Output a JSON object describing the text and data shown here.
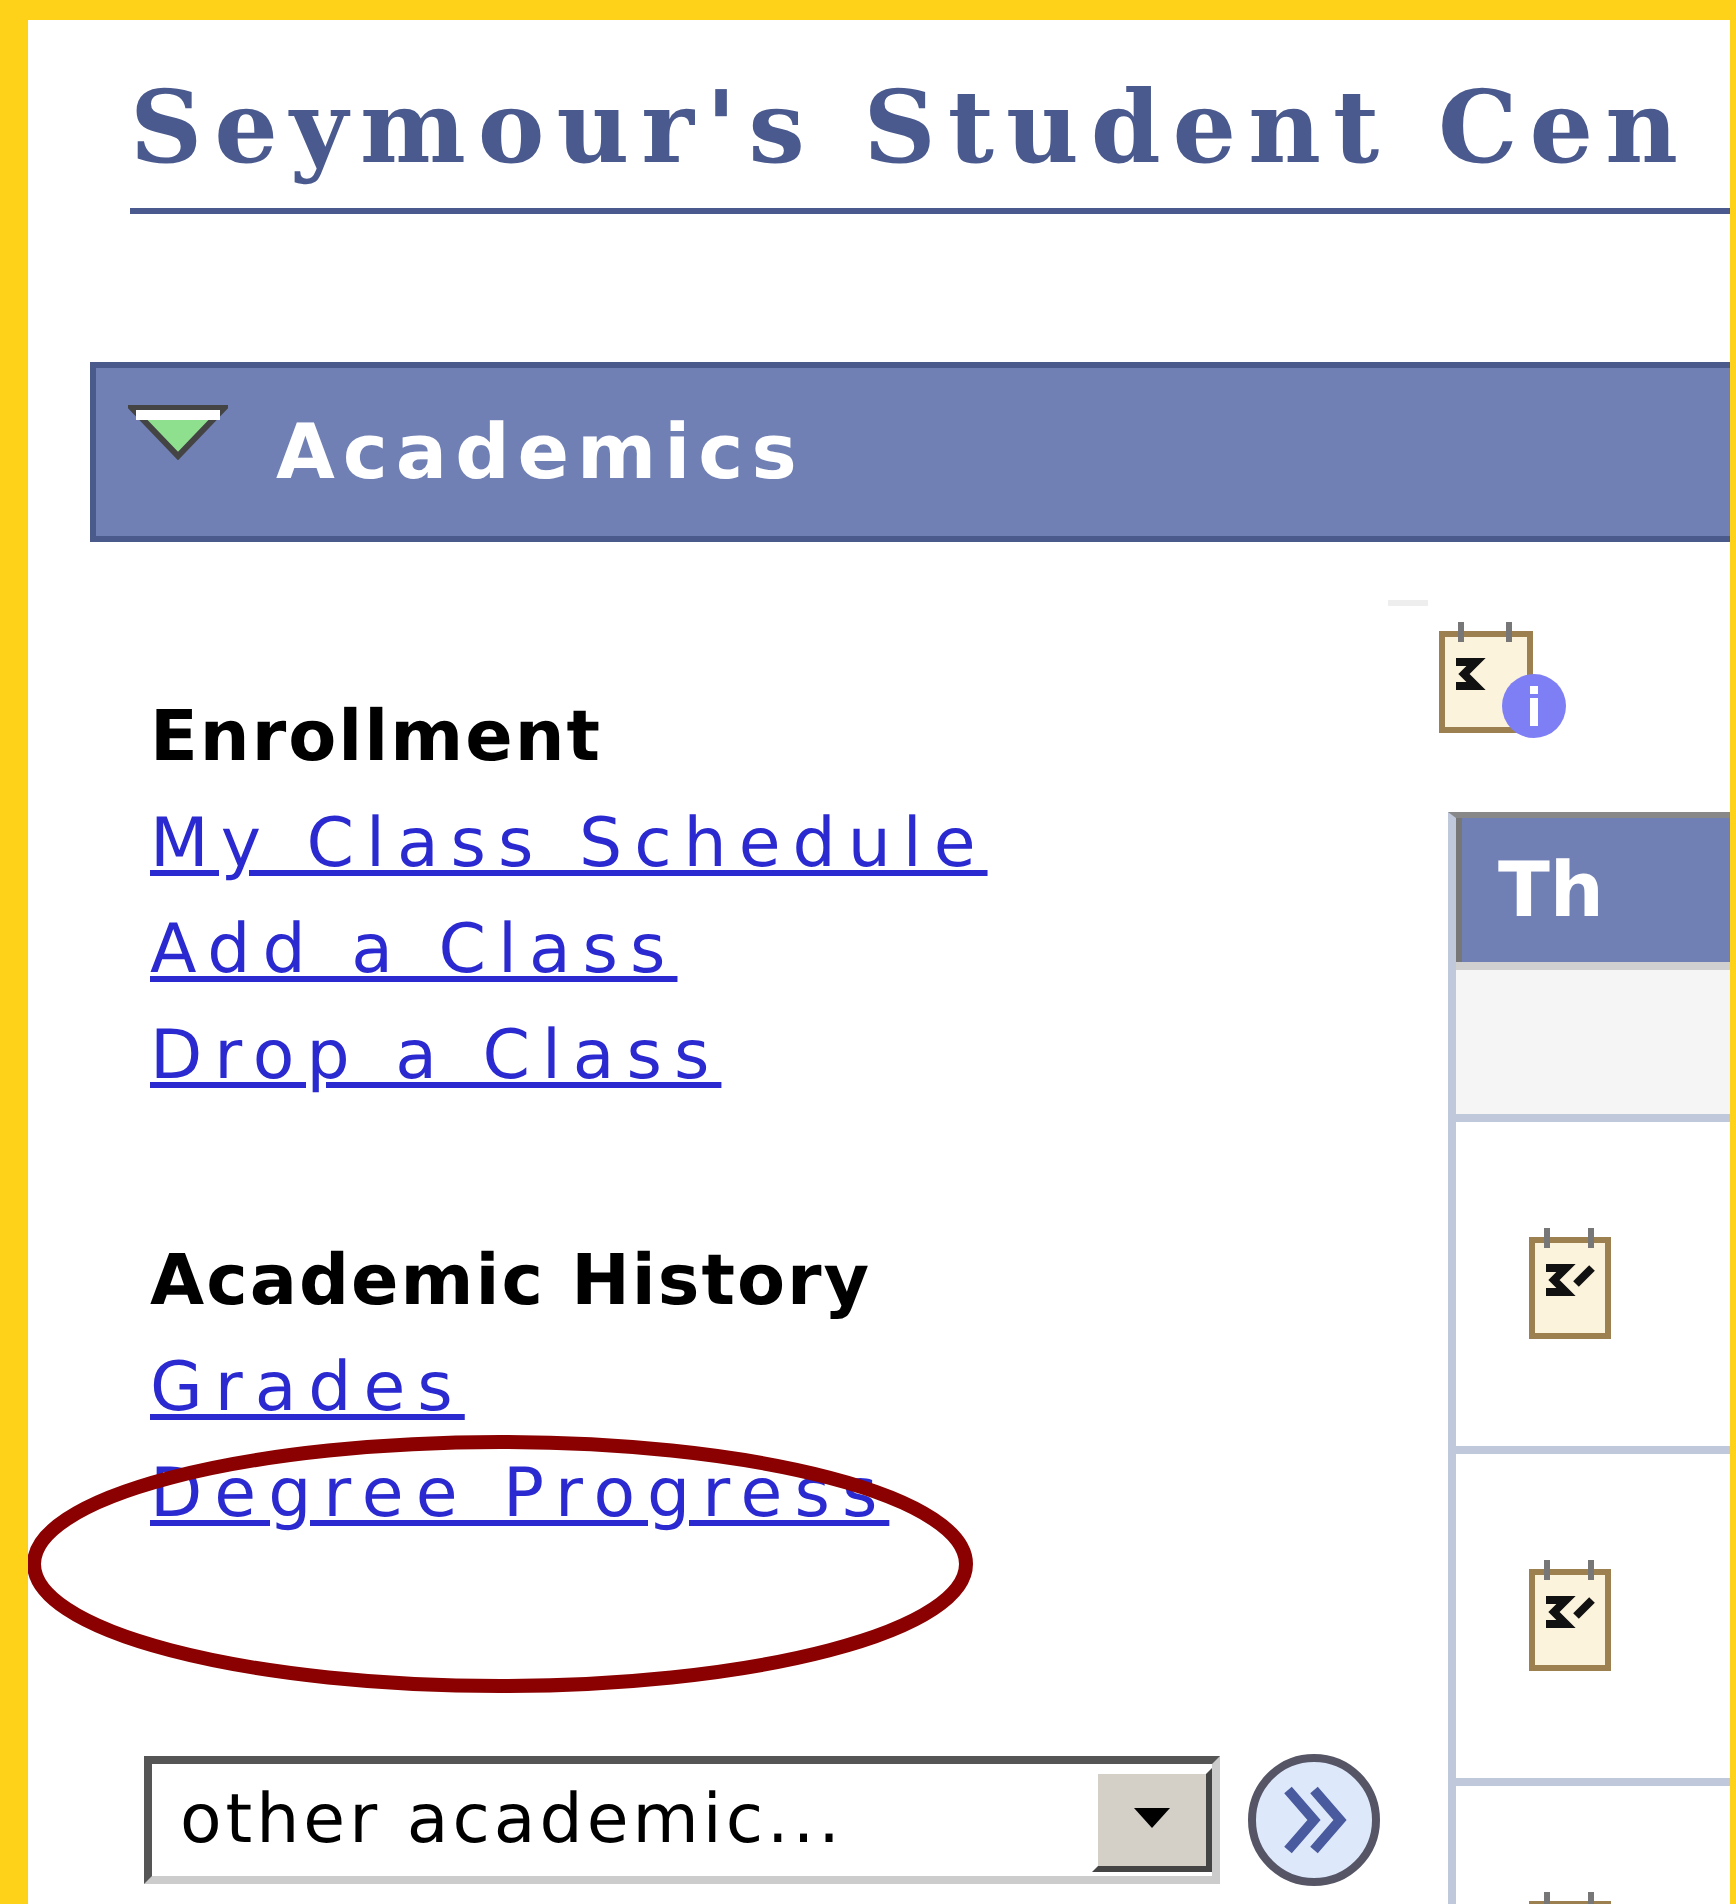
{
  "page": {
    "title": "Seymour's Student Cen"
  },
  "section": {
    "title": "Academics",
    "expanded": true
  },
  "link_groups": [
    {
      "heading": "Enrollment",
      "links": [
        "My Class Schedule",
        "Add a Class",
        "Drop a Class"
      ]
    },
    {
      "heading": "Academic History",
      "links": [
        "Grades",
        "Degree Progress"
      ]
    }
  ],
  "select": {
    "value": "other academic..."
  },
  "schedule_table": {
    "columns": [
      "Th"
    ]
  }
}
